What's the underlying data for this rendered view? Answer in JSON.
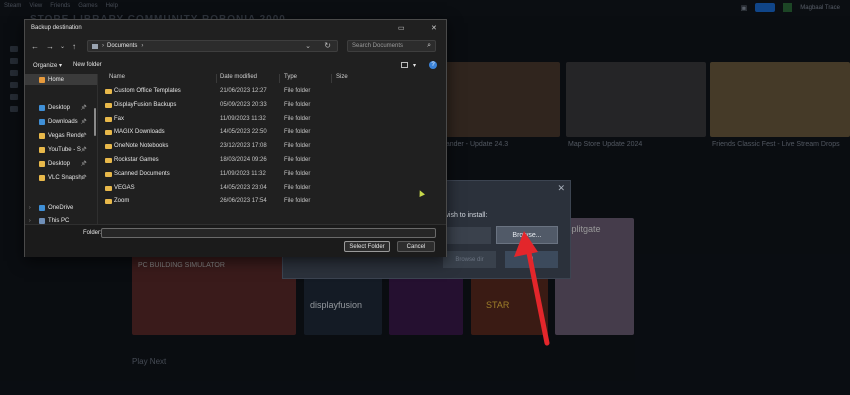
{
  "background": {
    "menu": [
      "Steam",
      "View",
      "Friends",
      "Games",
      "Help"
    ],
    "title": "STORE   LIBRARY   COMMUNITY   ROBONIA 2000",
    "user": "Magbaal Trace",
    "tiles": [
      {
        "label": "...ander - Update 24.3",
        "color": "#4a3a2e"
      },
      {
        "label": "Map Store Update 2024",
        "color": "#3a3a3c"
      },
      {
        "label": "Friends Classic Fest - Live Stream Drops",
        "color": "#6a5a3e"
      },
      {
        "label": "PC BUILDING SIMULATOR",
        "color": "#5a2a2a"
      },
      {
        "label": "displayfusion",
        "color": "#1f2a3a"
      },
      {
        "label": "STAR",
        "color": "#5a2a20"
      },
      {
        "label": "splitgate",
        "color": "#6a5c74"
      }
    ],
    "play_next": "Play Next"
  },
  "install_dialog": {
    "message": "u wish to install:",
    "browse_label": "Browse...",
    "secondary_label": "Browse dir",
    "primary_label": "d",
    "close": "✕"
  },
  "file_dialog": {
    "title": "Backup destination",
    "address": {
      "crumb": "Documents",
      "separator": "›"
    },
    "search_placeholder": "Search Documents",
    "toolbar": {
      "organize": "Organize ▾",
      "new_folder": "New folder"
    },
    "nav": [
      {
        "label": "Home",
        "selected": true,
        "icon_color": "#e79a3c"
      },
      {
        "label": "Desktop",
        "pinned": true,
        "icon_color": "#3f8fd6"
      },
      {
        "label": "Downloads",
        "pinned": true,
        "icon_color": "#3f8fd6"
      },
      {
        "label": "Vegas Rende",
        "pinned": true,
        "icon_color": "#e8b84a"
      },
      {
        "label": "YouTube - S",
        "pinned": true,
        "icon_color": "#e8b84a"
      },
      {
        "label": "Desktop",
        "pinned": true,
        "icon_color": "#e8b84a"
      },
      {
        "label": "VLC Snapsho",
        "pinned": true,
        "icon_color": "#e8b84a"
      },
      {
        "label": "OneDrive",
        "expand": true,
        "icon_color": "#3f8fd6"
      },
      {
        "label": "This PC",
        "expand": true,
        "icon_color": "#6f8fb8"
      }
    ],
    "columns": {
      "name": "Name",
      "date": "Date modified",
      "type": "Type",
      "size": "Size"
    },
    "files": [
      {
        "name": "Custom Office Templates",
        "date": "21/06/2023 12:27",
        "type": "File folder"
      },
      {
        "name": "DisplayFusion Backups",
        "date": "05/09/2023 20:33",
        "type": "File folder"
      },
      {
        "name": "Fax",
        "date": "11/09/2023 11:32",
        "type": "File folder"
      },
      {
        "name": "MAGIX Downloads",
        "date": "14/05/2023 22:50",
        "type": "File folder"
      },
      {
        "name": "OneNote Notebooks",
        "date": "23/12/2023 17:08",
        "type": "File folder"
      },
      {
        "name": "Rockstar Games",
        "date": "18/03/2024 09:26",
        "type": "File folder"
      },
      {
        "name": "Scanned Documents",
        "date": "11/09/2023 11:32",
        "type": "File folder"
      },
      {
        "name": "VEGAS",
        "date": "14/05/2023 23:04",
        "type": "File folder"
      },
      {
        "name": "Zoom",
        "date": "26/06/2023 17:54",
        "type": "File folder"
      }
    ],
    "folder_label": "Folder:",
    "folder_value": "",
    "select_label": "Select Folder",
    "cancel_label": "Cancel"
  }
}
